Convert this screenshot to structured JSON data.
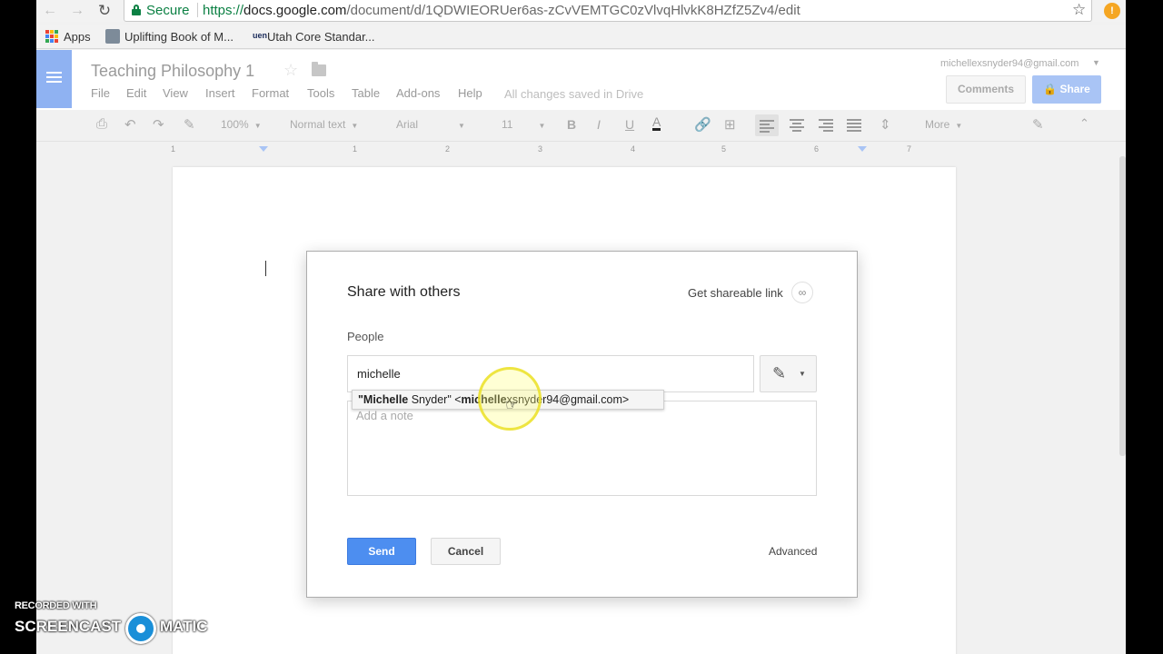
{
  "browser": {
    "secure_label": "Secure",
    "url_scheme": "https://",
    "url_host": "docs.google.com",
    "url_path": "/document/d/1QDWIEORUer6as-zCvVEMTGC0zVlvqHlvkK8HZfZ5Zv4/edit",
    "bookmarks": [
      "Apps",
      "Uplifting Book of M...",
      "Utah Core Standar..."
    ],
    "uen_badge": "uen"
  },
  "doc": {
    "title": "Teaching Philosophy 1",
    "menu": [
      "File",
      "Edit",
      "View",
      "Insert",
      "Format",
      "Tools",
      "Table",
      "Add-ons",
      "Help"
    ],
    "saved_status": "All changes saved in Drive",
    "account": "michellexsnyder94@gmail.com",
    "comments_label": "Comments",
    "share_label": "Share"
  },
  "toolbar": {
    "zoom": "100%",
    "style": "Normal text",
    "font": "Arial",
    "size": "11",
    "bold": "B",
    "italic": "I",
    "underline": "U",
    "text_color": "A",
    "more": "More"
  },
  "ruler": {
    "numbers": [
      "1",
      "1",
      "2",
      "3",
      "4",
      "5",
      "6",
      "7"
    ]
  },
  "dialog": {
    "title": "Share with others",
    "shareable_link": "Get shareable link",
    "people_label": "People",
    "people_value": "michelle",
    "note_placeholder": "Add a note",
    "suggestion": {
      "bold1": "\"Michelle",
      "text1": " Snyder\" <",
      "bold2": "michelle",
      "text2": "xsnyder94@gmail.com>"
    },
    "send_label": "Send",
    "cancel_label": "Cancel",
    "advanced_label": "Advanced"
  },
  "watermark": {
    "line1": "RECORDED WITH",
    "line2a": "SCREENCAST",
    "line2b": "MATIC"
  },
  "colors": {
    "docs_blue": "#8fb2f2",
    "send_blue": "#4d8ef0",
    "secure_green": "#0b8043"
  }
}
